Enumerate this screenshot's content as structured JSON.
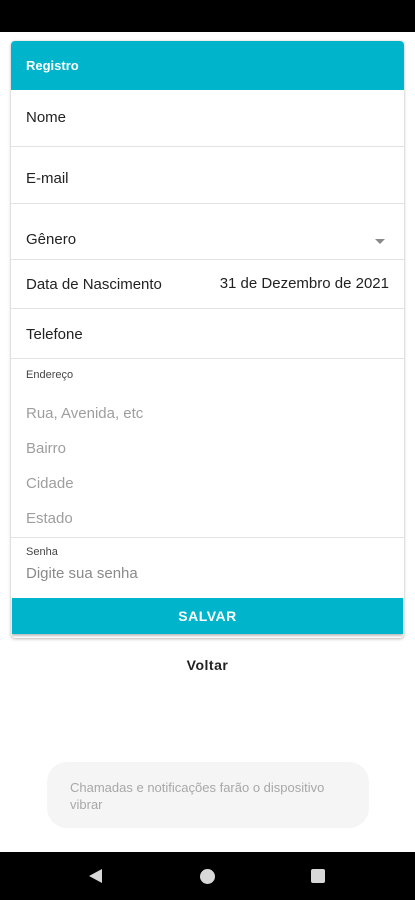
{
  "header": {
    "title": "Registro"
  },
  "form": {
    "nome_label": "Nome",
    "email_label": "E-mail",
    "genero_label": "Gênero",
    "nascimento_label": "Data de Nascimento",
    "nascimento_value": "31 de Dezembro de 2021",
    "telefone_label": "Telefone",
    "endereco": {
      "label": "Endereço",
      "rua_placeholder": "Rua, Avenida, etc",
      "bairro_placeholder": "Bairro",
      "cidade_placeholder": "Cidade",
      "estado_placeholder": "Estado"
    },
    "senha": {
      "label": "Senha",
      "placeholder": "Digite sua senha"
    },
    "save_label": "SALVAR"
  },
  "back_label": "Voltar",
  "toast": {
    "text": "Chamadas e notificações farão o dispositivo vibrar"
  },
  "icons": {
    "dropdown": "chevron-down-icon",
    "nav_back": "nav-back-icon",
    "nav_home": "nav-home-icon",
    "nav_recent": "nav-recent-icon"
  },
  "colors": {
    "accent": "#00b5cb"
  }
}
